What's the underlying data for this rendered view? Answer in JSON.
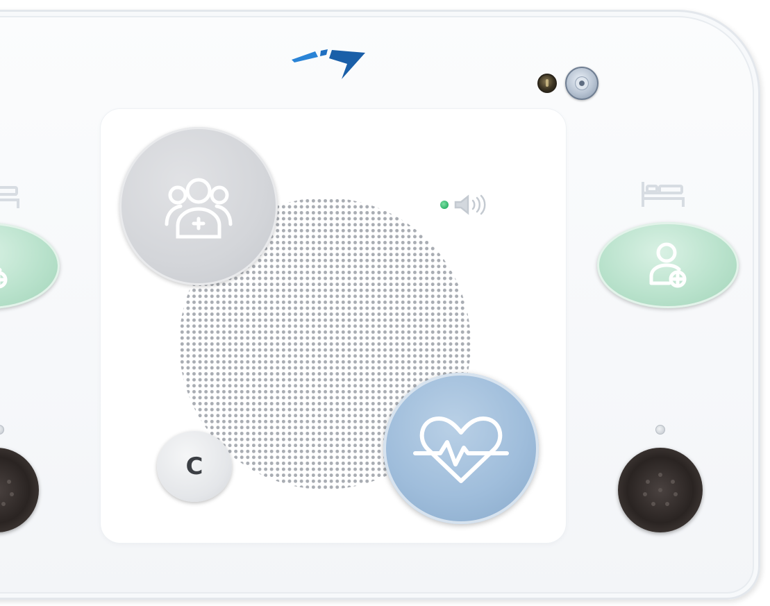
{
  "panel": {
    "cancel_button_label": "C"
  },
  "icons": {
    "logo": "brand-arrow-logo",
    "status": "status-led",
    "camera": "camera-lens",
    "staff": "care-team-icon",
    "emergency": "heart-pulse-icon",
    "volume": "speaker-volume-icon",
    "bed": "bed-icon",
    "nurse": "nurse-call-icon"
  },
  "colors": {
    "logo_blue": "#1e6fc1",
    "staff_button": "#d3d5d9",
    "emergency_button": "#9fbddb",
    "nurse_call": "#b9e2cc",
    "volume_led": "#2fb36a",
    "grille_dots": "#a9adb3",
    "jack": "#2a2422"
  }
}
